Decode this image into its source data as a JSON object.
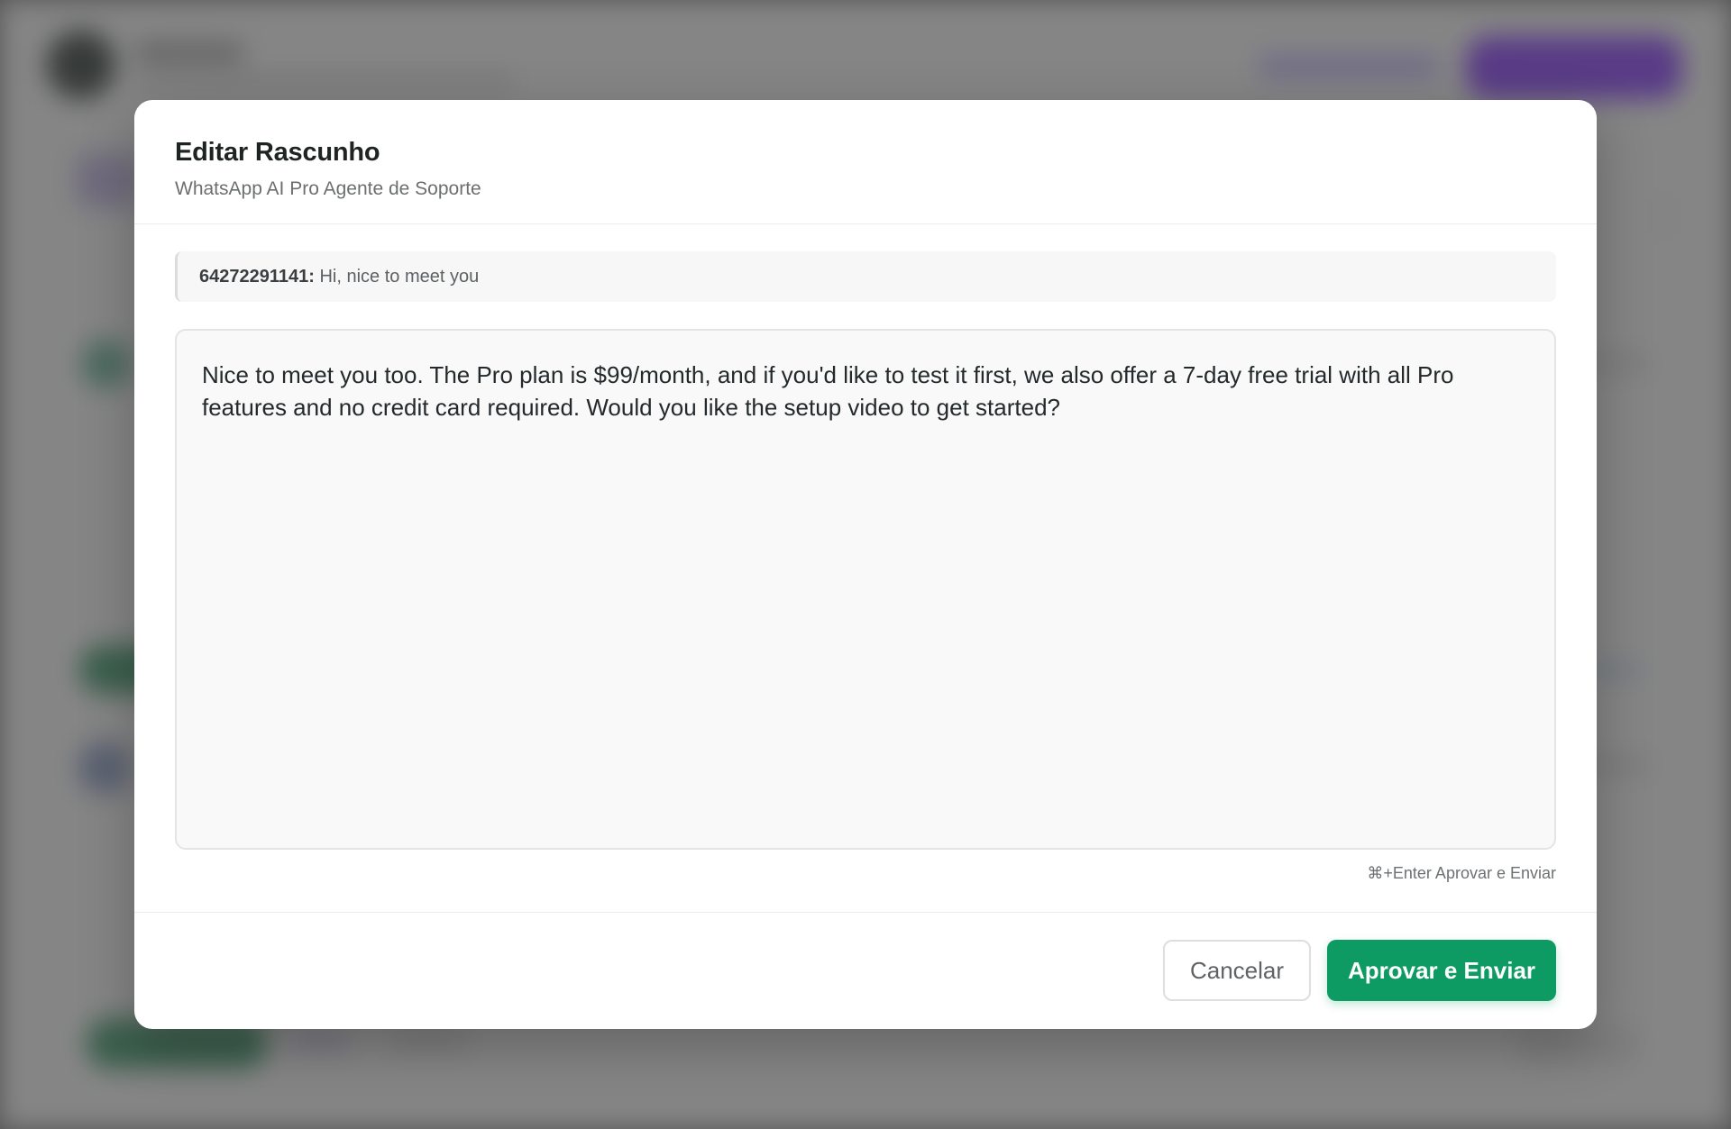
{
  "modal": {
    "title": "Editar Rascunho",
    "subtitle": "WhatsApp AI Pro Agente de Soporte"
  },
  "incoming_message": {
    "sender": "64272291141:",
    "text": "Hi, nice to meet you"
  },
  "draft": {
    "text": "Nice to meet you too. The Pro plan is $99/month, and if you'd like to test it first, we also offer a 7-day free trial with all Pro features and no credit card required. Would you like the setup video to get started?"
  },
  "shortcut_hint": "⌘+Enter Aprovar e Enviar",
  "footer": {
    "cancel_label": "Cancelar",
    "approve_label": "Aprovar e Enviar"
  },
  "colors": {
    "approve_button": "#0e9a63",
    "background_primary_button": "#7a2cf0"
  }
}
